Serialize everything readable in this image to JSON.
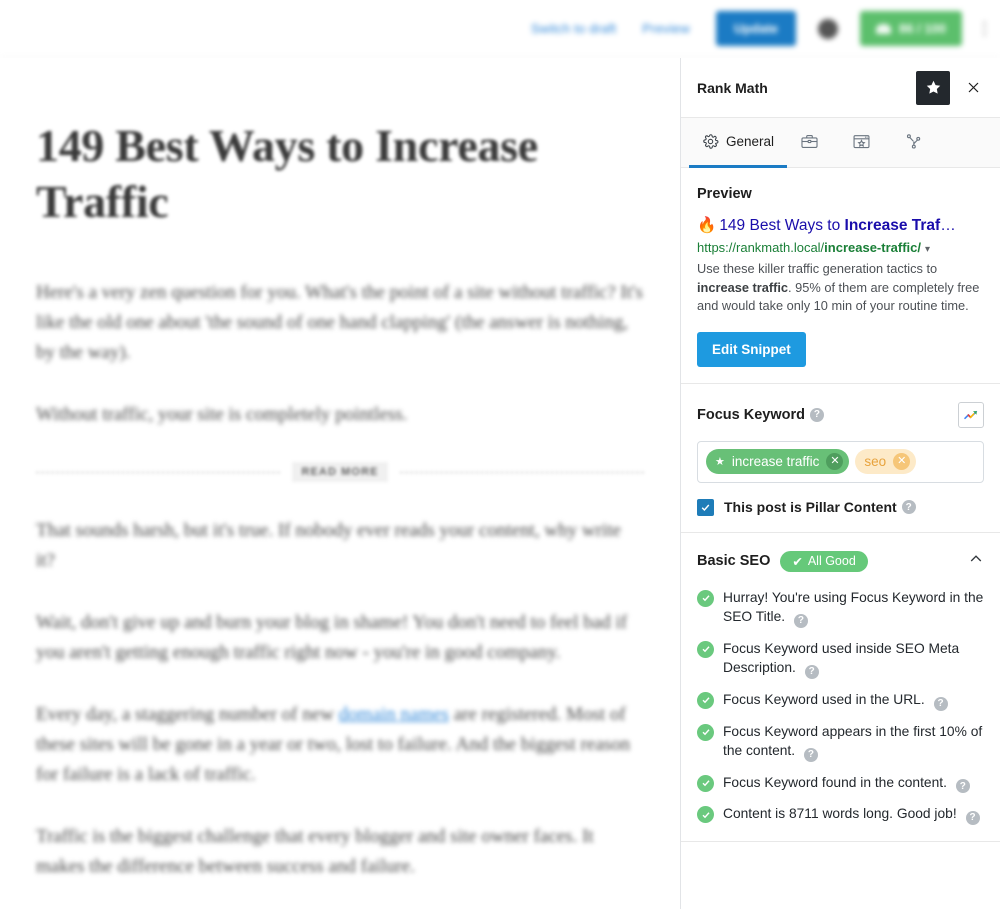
{
  "toolbar": {
    "switch_to_draft": "Switch to draft",
    "preview": "Preview",
    "update": "Update",
    "seo_score": "86 / 100",
    "more_options": "⋮"
  },
  "editor": {
    "post_title": "149 Best Ways to Increase Traffic",
    "paragraph_1": "Here's a very zen question for you. What's the point of a site without traffic? It's like the old one about 'the sound of one hand clapping' (the answer is nothing, by the way).",
    "paragraph_2": "Without traffic, your site is completely pointless.",
    "read_more_label": "READ MORE",
    "paragraph_3": "That sounds harsh, but it's true. If nobody ever reads your content, why write it?",
    "paragraph_4": "Wait, don't give up and burn your blog in shame! You don't need to feel bad if you aren't getting enough traffic right now - you're in good company.",
    "paragraph_5_before": "Every day, a staggering number of new ",
    "paragraph_5_link": "domain names",
    "paragraph_5_after": " are registered. Most of these sites will be gone in a year or two, lost to failure. And the biggest reason for failure is a lack of traffic.",
    "paragraph_6": "Traffic is the biggest challenge that every blogger and site owner faces. It makes the difference between success and failure."
  },
  "sidebar": {
    "title": "Rank Math",
    "star_icon": "star-icon",
    "close_icon": "close-icon",
    "tabs": [
      {
        "label": "General",
        "icon": "gear-icon",
        "active": true
      },
      {
        "label": "",
        "icon": "briefcase-icon",
        "active": false
      },
      {
        "label": "",
        "icon": "schema-browser-icon",
        "active": false
      },
      {
        "label": "",
        "icon": "social-share-icon",
        "active": false
      }
    ],
    "preview": {
      "heading": "Preview",
      "fire_emoji": "🔥",
      "title_plain": "149 Best Ways to ",
      "title_bold": "Increase Traf",
      "title_ellipsis": "…",
      "url_plain": "https://rankmath.local/",
      "url_bold": "increase-traffic/",
      "url_caret": "▾",
      "desc_before": "Use these killer traffic generation tactics to ",
      "desc_bold": "increase traffic",
      "desc_after": ". 95% of them are completely free and would take only 10 min of your routine time.",
      "edit_snippet_button": "Edit Snippet"
    },
    "focus_keyword": {
      "label": "Focus Keyword",
      "help": "?",
      "trends_icon": "google-trends-icon",
      "keywords": [
        {
          "text": "increase traffic",
          "primary": true,
          "remove": "✕",
          "star": "★"
        },
        {
          "text": "seo",
          "primary": false,
          "remove": "✕"
        }
      ],
      "pillar_label": "This post is Pillar Content",
      "pillar_help": "?",
      "pillar_checked": true,
      "pillar_check_glyph": "✓"
    },
    "basic_seo": {
      "title": "Basic SEO",
      "badge": "All Good",
      "badge_check": "✔",
      "collapse_icon": "chevron-up-icon",
      "items": [
        {
          "status": "ok",
          "text": "Hurray! You're using Focus Keyword in the SEO Title.",
          "help": "?"
        },
        {
          "status": "ok",
          "text": "Focus Keyword used inside SEO Meta Description.",
          "help": "?"
        },
        {
          "status": "ok",
          "text": "Focus Keyword used in the URL.",
          "help": "?"
        },
        {
          "status": "ok",
          "text": "Focus Keyword appears in the first 10% of the content.",
          "help": "?"
        },
        {
          "status": "ok",
          "text": "Focus Keyword found in the content.",
          "help": "?"
        },
        {
          "status": "ok",
          "text": "Content is 8711 words long. Good job!",
          "help": "?"
        }
      ]
    }
  },
  "colors": {
    "accent_blue": "#1b7bc4",
    "link_blue": "#1a0dab",
    "url_green": "#1a7f37",
    "success_green": "#66c97a",
    "keyword_green": "#68c077",
    "keyword_orange": "#fdeac8",
    "dark": "#23282d"
  }
}
